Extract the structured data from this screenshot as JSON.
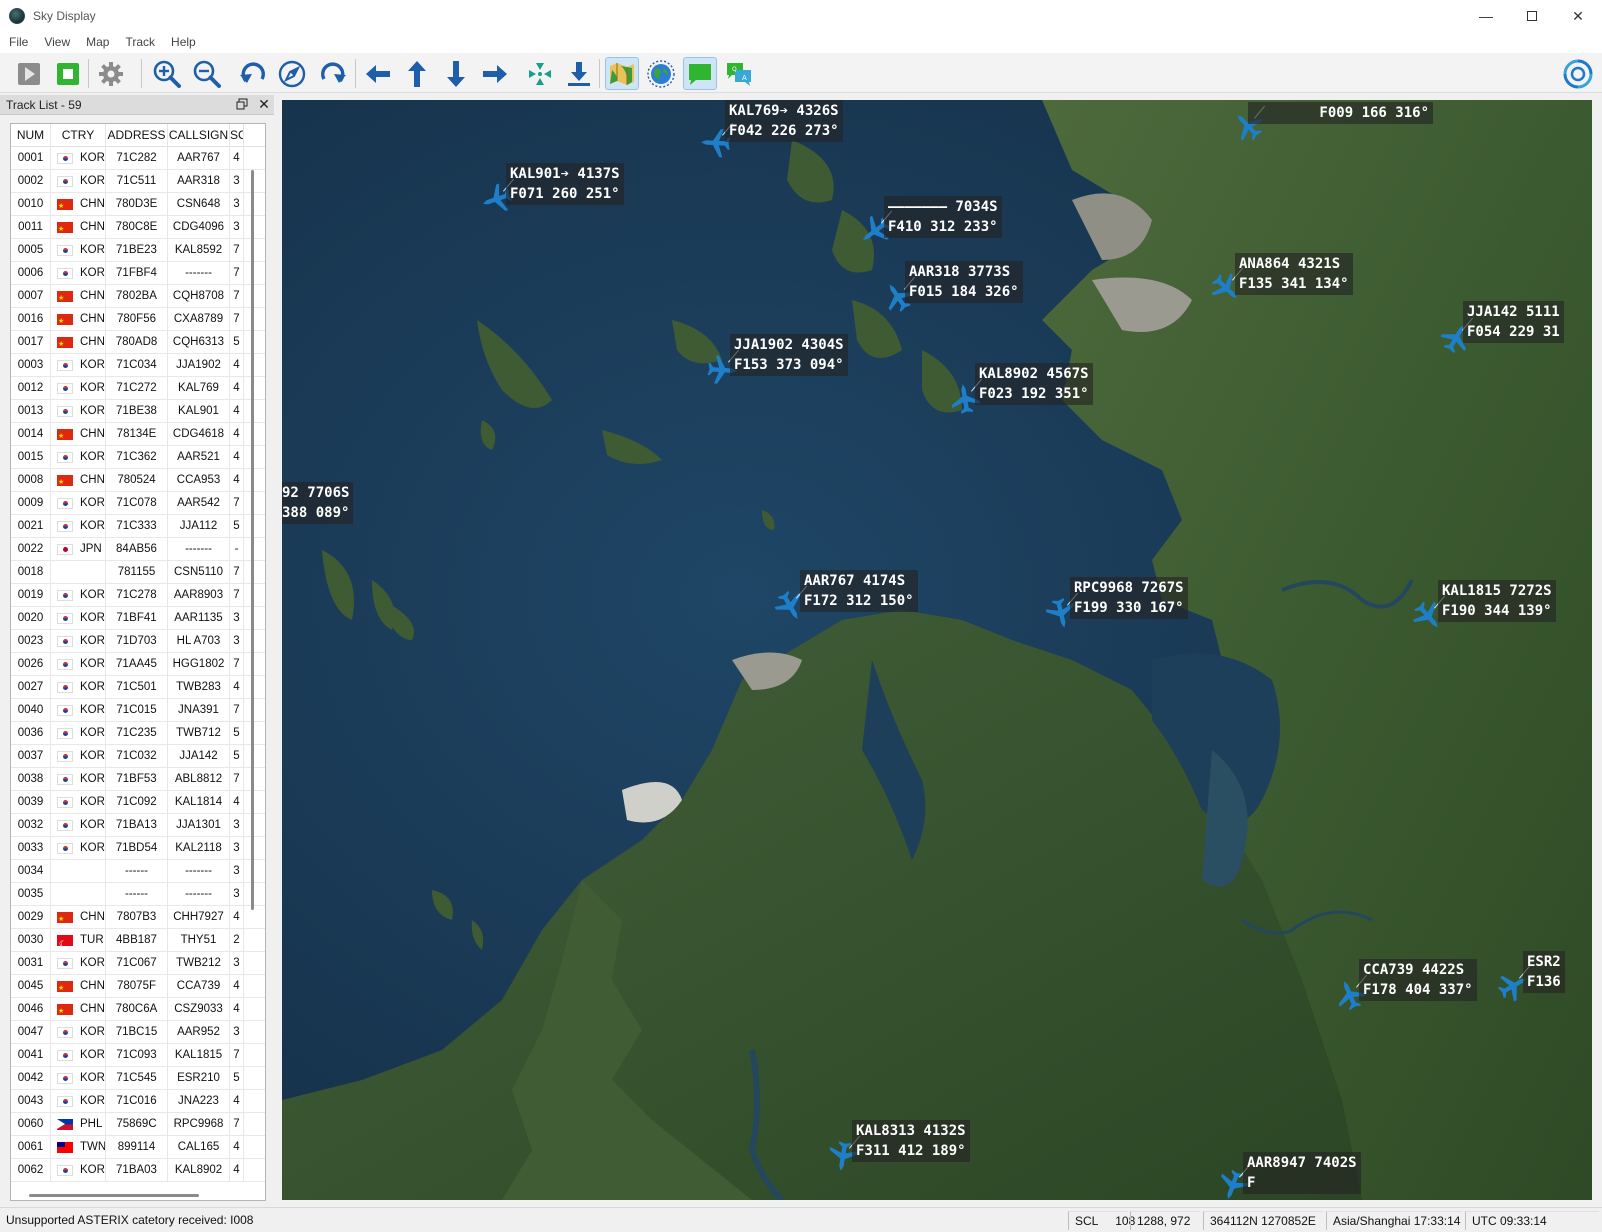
{
  "window": {
    "title": "Sky Display"
  },
  "menu": {
    "items": [
      "File",
      "View",
      "Map",
      "Track",
      "Help"
    ]
  },
  "toolbar": {
    "buttons": [
      "play-icon",
      "stop-icon",
      "gear-icon",
      "zoom-in-icon",
      "zoom-out-icon",
      "rotate-left-icon",
      "compass-icon",
      "rotate-right-icon",
      "pan-left-icon",
      "pan-up-icon",
      "pan-down-icon",
      "pan-right-icon",
      "center-icon",
      "download-icon",
      "map-layer-icon",
      "globe-icon",
      "label-icon",
      "label-alt-icon"
    ],
    "active": [
      "map-layer-icon",
      "label-icon"
    ]
  },
  "track_list": {
    "title": "Track List - 59",
    "columns": [
      "NUM",
      "CTRY",
      "ADDRESS",
      "CALLSIGN",
      "SQ"
    ],
    "rows": [
      {
        "num": "0001",
        "ctry": "KOR",
        "addr": "71C282",
        "cs": "AAR767",
        "sq": "4"
      },
      {
        "num": "0002",
        "ctry": "KOR",
        "addr": "71C511",
        "cs": "AAR318",
        "sq": "3"
      },
      {
        "num": "0010",
        "ctry": "CHN",
        "addr": "780D3E",
        "cs": "CSN648",
        "sq": "3"
      },
      {
        "num": "0011",
        "ctry": "CHN",
        "addr": "780C8E",
        "cs": "CDG4096",
        "sq": "3"
      },
      {
        "num": "0005",
        "ctry": "KOR",
        "addr": "71BE23",
        "cs": "KAL8592",
        "sq": "7"
      },
      {
        "num": "0006",
        "ctry": "KOR",
        "addr": "71FBF4",
        "cs": "-------",
        "sq": "7"
      },
      {
        "num": "0007",
        "ctry": "CHN",
        "addr": "7802BA",
        "cs": "CQH8708",
        "sq": "7"
      },
      {
        "num": "0016",
        "ctry": "CHN",
        "addr": "780F56",
        "cs": "CXA8789",
        "sq": "7"
      },
      {
        "num": "0017",
        "ctry": "CHN",
        "addr": "780AD8",
        "cs": "CQH6313",
        "sq": "5"
      },
      {
        "num": "0003",
        "ctry": "KOR",
        "addr": "71C034",
        "cs": "JJA1902",
        "sq": "4"
      },
      {
        "num": "0012",
        "ctry": "KOR",
        "addr": "71C272",
        "cs": "KAL769",
        "sq": "4"
      },
      {
        "num": "0013",
        "ctry": "KOR",
        "addr": "71BE38",
        "cs": "KAL901",
        "sq": "4"
      },
      {
        "num": "0014",
        "ctry": "CHN",
        "addr": "78134E",
        "cs": "CDG4618",
        "sq": "4"
      },
      {
        "num": "0015",
        "ctry": "KOR",
        "addr": "71C362",
        "cs": "AAR521",
        "sq": "4"
      },
      {
        "num": "0008",
        "ctry": "CHN",
        "addr": "780524",
        "cs": "CCA953",
        "sq": "4"
      },
      {
        "num": "0009",
        "ctry": "KOR",
        "addr": "71C078",
        "cs": "AAR542",
        "sq": "7"
      },
      {
        "num": "0021",
        "ctry": "KOR",
        "addr": "71C333",
        "cs": "JJA112",
        "sq": "5"
      },
      {
        "num": "0022",
        "ctry": "JPN",
        "addr": "84AB56",
        "cs": "-------",
        "sq": "-"
      },
      {
        "num": "0018",
        "ctry": "",
        "addr": "781155",
        "cs": "CSN5110",
        "sq": "7"
      },
      {
        "num": "0019",
        "ctry": "KOR",
        "addr": "71C278",
        "cs": "AAR8903",
        "sq": "7"
      },
      {
        "num": "0020",
        "ctry": "KOR",
        "addr": "71BF41",
        "cs": "AAR1135",
        "sq": "3"
      },
      {
        "num": "0023",
        "ctry": "KOR",
        "addr": "71D703",
        "cs": "HL A703",
        "sq": "3"
      },
      {
        "num": "0026",
        "ctry": "KOR",
        "addr": "71AA45",
        "cs": "HGG1802",
        "sq": "7"
      },
      {
        "num": "0027",
        "ctry": "KOR",
        "addr": "71C501",
        "cs": "TWB283",
        "sq": "4"
      },
      {
        "num": "0040",
        "ctry": "KOR",
        "addr": "71C015",
        "cs": "JNA391",
        "sq": "7"
      },
      {
        "num": "0036",
        "ctry": "KOR",
        "addr": "71C235",
        "cs": "TWB712",
        "sq": "5"
      },
      {
        "num": "0037",
        "ctry": "KOR",
        "addr": "71C032",
        "cs": "JJA142",
        "sq": "5"
      },
      {
        "num": "0038",
        "ctry": "KOR",
        "addr": "71BF53",
        "cs": "ABL8812",
        "sq": "7"
      },
      {
        "num": "0039",
        "ctry": "KOR",
        "addr": "71C092",
        "cs": "KAL1814",
        "sq": "4"
      },
      {
        "num": "0032",
        "ctry": "KOR",
        "addr": "71BA13",
        "cs": "JJA1301",
        "sq": "3"
      },
      {
        "num": "0033",
        "ctry": "KOR",
        "addr": "71BD54",
        "cs": "KAL2118",
        "sq": "3"
      },
      {
        "num": "0034",
        "ctry": "",
        "addr": "------",
        "cs": "-------",
        "sq": "3"
      },
      {
        "num": "0035",
        "ctry": "",
        "addr": "------",
        "cs": "-------",
        "sq": "3"
      },
      {
        "num": "0029",
        "ctry": "CHN",
        "addr": "7807B3",
        "cs": "CHH7927",
        "sq": "4"
      },
      {
        "num": "0030",
        "ctry": "TUR",
        "addr": "4BB187",
        "cs": "THY51",
        "sq": "2"
      },
      {
        "num": "0031",
        "ctry": "KOR",
        "addr": "71C067",
        "cs": "TWB212",
        "sq": "3"
      },
      {
        "num": "0045",
        "ctry": "CHN",
        "addr": "78075F",
        "cs": "CCA739",
        "sq": "4"
      },
      {
        "num": "0046",
        "ctry": "CHN",
        "addr": "780C6A",
        "cs": "CSZ9033",
        "sq": "4"
      },
      {
        "num": "0047",
        "ctry": "KOR",
        "addr": "71BC15",
        "cs": "AAR952",
        "sq": "3"
      },
      {
        "num": "0041",
        "ctry": "KOR",
        "addr": "71C093",
        "cs": "KAL1815",
        "sq": "7"
      },
      {
        "num": "0042",
        "ctry": "KOR",
        "addr": "71C545",
        "cs": "ESR210",
        "sq": "5"
      },
      {
        "num": "0043",
        "ctry": "KOR",
        "addr": "71C016",
        "cs": "JNA223",
        "sq": "4"
      },
      {
        "num": "0060",
        "ctry": "PHL",
        "addr": "75869C",
        "cs": "RPC9968",
        "sq": "7"
      },
      {
        "num": "0061",
        "ctry": "TWN",
        "addr": "899114",
        "cs": "CAL165",
        "sq": "4"
      },
      {
        "num": "0062",
        "ctry": "KOR",
        "addr": "71BA03",
        "cs": "KAL8902",
        "sq": "4"
      }
    ]
  },
  "map": {
    "tracks": [
      {
        "line1": "KAL769➔ 4326S",
        "line2": "F042 226 273°",
        "heading": 273
      },
      {
        "line1": "        F009 166 316°",
        "line2": "",
        "heading": 316
      },
      {
        "line1": "KAL901➔ 4137S",
        "line2": "F071 260 251°",
        "heading": 251
      },
      {
        "line1": "——————— 7034S",
        "line2": "F410 312 233°",
        "heading": 233
      },
      {
        "line1": "AAR318 3773S",
        "line2": "F015 184 326°",
        "heading": 326
      },
      {
        "line1": "ANA864 4321S",
        "line2": "F135 341 134°",
        "heading": 134
      },
      {
        "line1": "JJA142 5111",
        "line2": "F054 229 31",
        "heading": 31
      },
      {
        "line1": "JJA1902 4304S",
        "line2": "F153 373 094°",
        "heading": 94
      },
      {
        "line1": "KAL8902 4567S",
        "line2": "F023 192 351°",
        "heading": 351
      },
      {
        "line1": "92 7706S",
        "line2": "388 089°",
        "heading": 89
      },
      {
        "line1": "AAR767 4174S",
        "line2": "F172 312 150°",
        "heading": 150
      },
      {
        "line1": "RPC9968 7267S",
        "line2": "F199 330 167°",
        "heading": 167
      },
      {
        "line1": "KAL1815 7272S",
        "line2": "F190 344 139°",
        "heading": 139
      },
      {
        "line1": "CCA739 4422S",
        "line2": "F178 404 337°",
        "heading": 337
      },
      {
        "line1": "ESR2",
        "line2": "F136",
        "heading": 60
      },
      {
        "line1": "KAL8313 4132S",
        "line2": "F311 412 189°",
        "heading": 189
      },
      {
        "line1": "AAR8947 7402S",
        "line2": "F",
        "heading": 200
      }
    ]
  },
  "status": {
    "message": "Unsupported ASTERIX catetory received: I008",
    "scale_label": "SCL",
    "scale_value": "108",
    "cursor": "1288, 972",
    "coord": "364112N 1270852E",
    "local_time": "Asia/Shanghai 17:33:14",
    "utc_time": "UTC 09:33:14"
  },
  "colors": {
    "plane": "#1e7fc8",
    "accent": "#0078d4"
  }
}
